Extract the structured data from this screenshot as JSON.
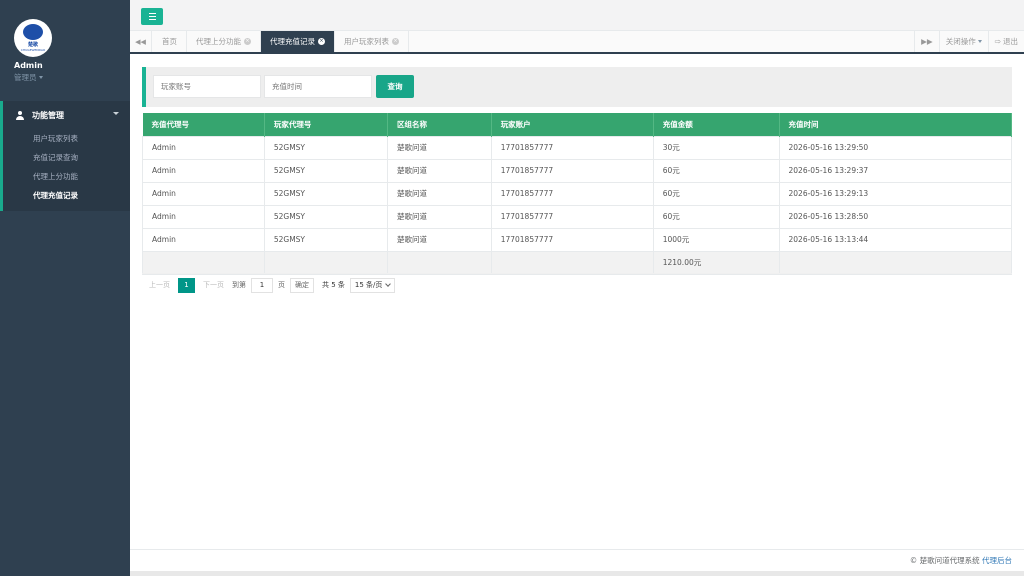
{
  "sidebar": {
    "profile": {
      "name": "Admin",
      "role": "管理员",
      "logo_text": "楚歌",
      "logo_sub": "CHUGEWENDAO"
    },
    "menu": {
      "title": "功能管理",
      "items": [
        {
          "label": "用户玩家列表"
        },
        {
          "label": "充值记录查询"
        },
        {
          "label": "代理上分功能"
        },
        {
          "label": "代理充值记录"
        }
      ]
    }
  },
  "tabs": {
    "items": [
      {
        "label": "首页"
      },
      {
        "label": "代理上分功能"
      },
      {
        "label": "代理充值记录"
      },
      {
        "label": "用户玩家列表"
      }
    ],
    "close_action": "关闭操作",
    "logout": "退出"
  },
  "search": {
    "account_placeholder": "玩家账号",
    "time_placeholder": "充值时间",
    "query_label": "查询"
  },
  "table": {
    "headers": [
      "充值代理号",
      "玩家代理号",
      "区组名称",
      "玩家账户",
      "充值金额",
      "充值时间"
    ],
    "rows": [
      [
        "Admin",
        "52GMSY",
        "楚歌问道",
        "17701857777",
        "30元",
        "2026-05-16 13:29:50"
      ],
      [
        "Admin",
        "52GMSY",
        "楚歌问道",
        "17701857777",
        "60元",
        "2026-05-16 13:29:37"
      ],
      [
        "Admin",
        "52GMSY",
        "楚歌问道",
        "17701857777",
        "60元",
        "2026-05-16 13:29:13"
      ],
      [
        "Admin",
        "52GMSY",
        "楚歌问道",
        "17701857777",
        "60元",
        "2026-05-16 13:28:50"
      ],
      [
        "Admin",
        "52GMSY",
        "楚歌问道",
        "17701857777",
        "1000元",
        "2026-05-16 13:13:44"
      ]
    ],
    "total": "1210.00元"
  },
  "pager": {
    "prev": "上一页",
    "current": "1",
    "next": "下一页",
    "goto": "到第",
    "page_value": "1",
    "page_unit": "页",
    "confirm": "确定",
    "total": "共 5 条",
    "per_page": "15 条/页"
  },
  "footer": {
    "copyright": "© 楚歌问道代理系统",
    "link": "代理后台"
  },
  "colors": {
    "accent": "#1ab394",
    "sidebar": "#2f4050",
    "table_header": "#36a56f"
  }
}
